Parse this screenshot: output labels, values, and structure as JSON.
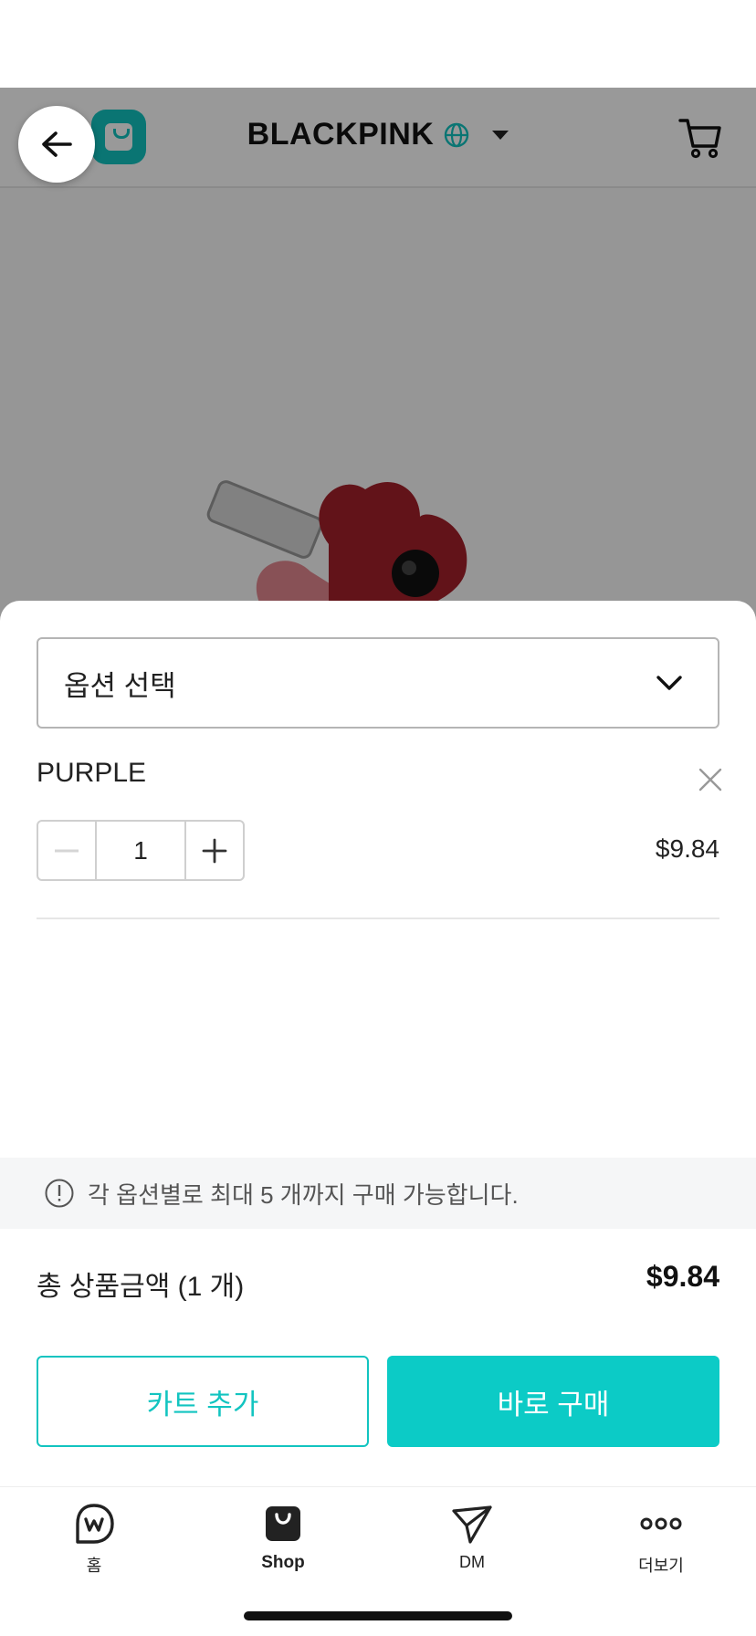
{
  "header": {
    "artist_name": "BLACKPINK",
    "icons": [
      "back-arrow-icon",
      "weverse-shop-logo",
      "globe-icon",
      "chevron-down-icon",
      "cart-icon"
    ]
  },
  "sheet": {
    "option_select_label": "옵션 선택",
    "selected_option": {
      "name": "PURPLE",
      "quantity": "1",
      "price": "$9.84"
    },
    "limit_notice": "각 옵션별로 최대 5 개까지 구매 가능합니다.",
    "total_label": "총 상품금액 (1 개)",
    "total_value": "$9.84",
    "add_to_cart_label": "카트 추가",
    "buy_now_label": "바로 구매"
  },
  "tabbar": {
    "items": [
      {
        "label": "홈",
        "icon": "weverse-home-icon",
        "active": false
      },
      {
        "label": "Shop",
        "icon": "shop-bag-icon",
        "active": true
      },
      {
        "label": "DM",
        "icon": "paper-plane-icon",
        "active": false
      },
      {
        "label": "더보기",
        "icon": "more-dots-icon",
        "active": false
      }
    ]
  },
  "colors": {
    "accent": "#0ccbc6",
    "overlay": "rgba(0,0,0,0.4)"
  }
}
